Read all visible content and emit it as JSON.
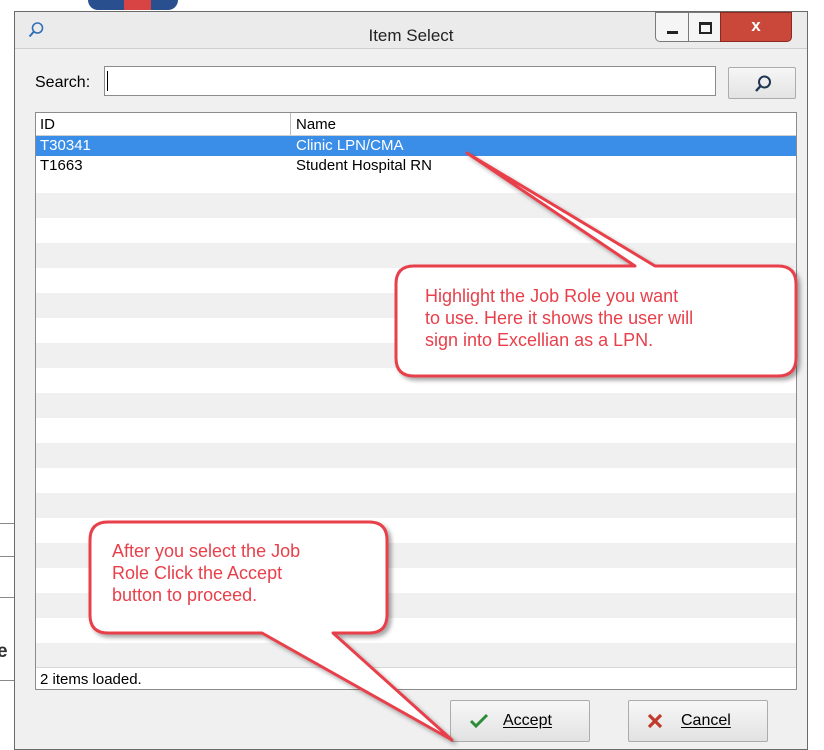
{
  "window": {
    "title": "Item Select",
    "close_glyph": "x"
  },
  "search": {
    "label": "Search:",
    "value": "",
    "placeholder": ""
  },
  "list": {
    "columns": [
      "ID",
      "Name"
    ],
    "rows": [
      {
        "id": "T30341",
        "name": "Clinic LPN/CMA",
        "selected": true
      },
      {
        "id": "T1663",
        "name": "Student Hospital RN",
        "selected": false
      }
    ],
    "status": "2 items loaded."
  },
  "buttons": {
    "accept": "Accept",
    "cancel": "Cancel"
  },
  "callouts": {
    "top": [
      "Highlight the Job Role you want",
      "to use. Here it shows the user will",
      "sign into Excellian as a LPN."
    ],
    "bottom": [
      "After you select the Job",
      "Role Click the Accept",
      "button to proceed."
    ]
  },
  "background": {
    "partial_letter": "e"
  },
  "icons": {
    "title": "search-icon",
    "search_button": "search-icon",
    "accept": "check-icon",
    "cancel": "x-icon"
  },
  "colors": {
    "selection": "#3b8ee8",
    "callout_fill": "#e8404b",
    "callout_text": "#e8404b",
    "close_button": "#c9483a",
    "accept_check": "#2e8b3a",
    "cancel_x": "#c0392b"
  }
}
